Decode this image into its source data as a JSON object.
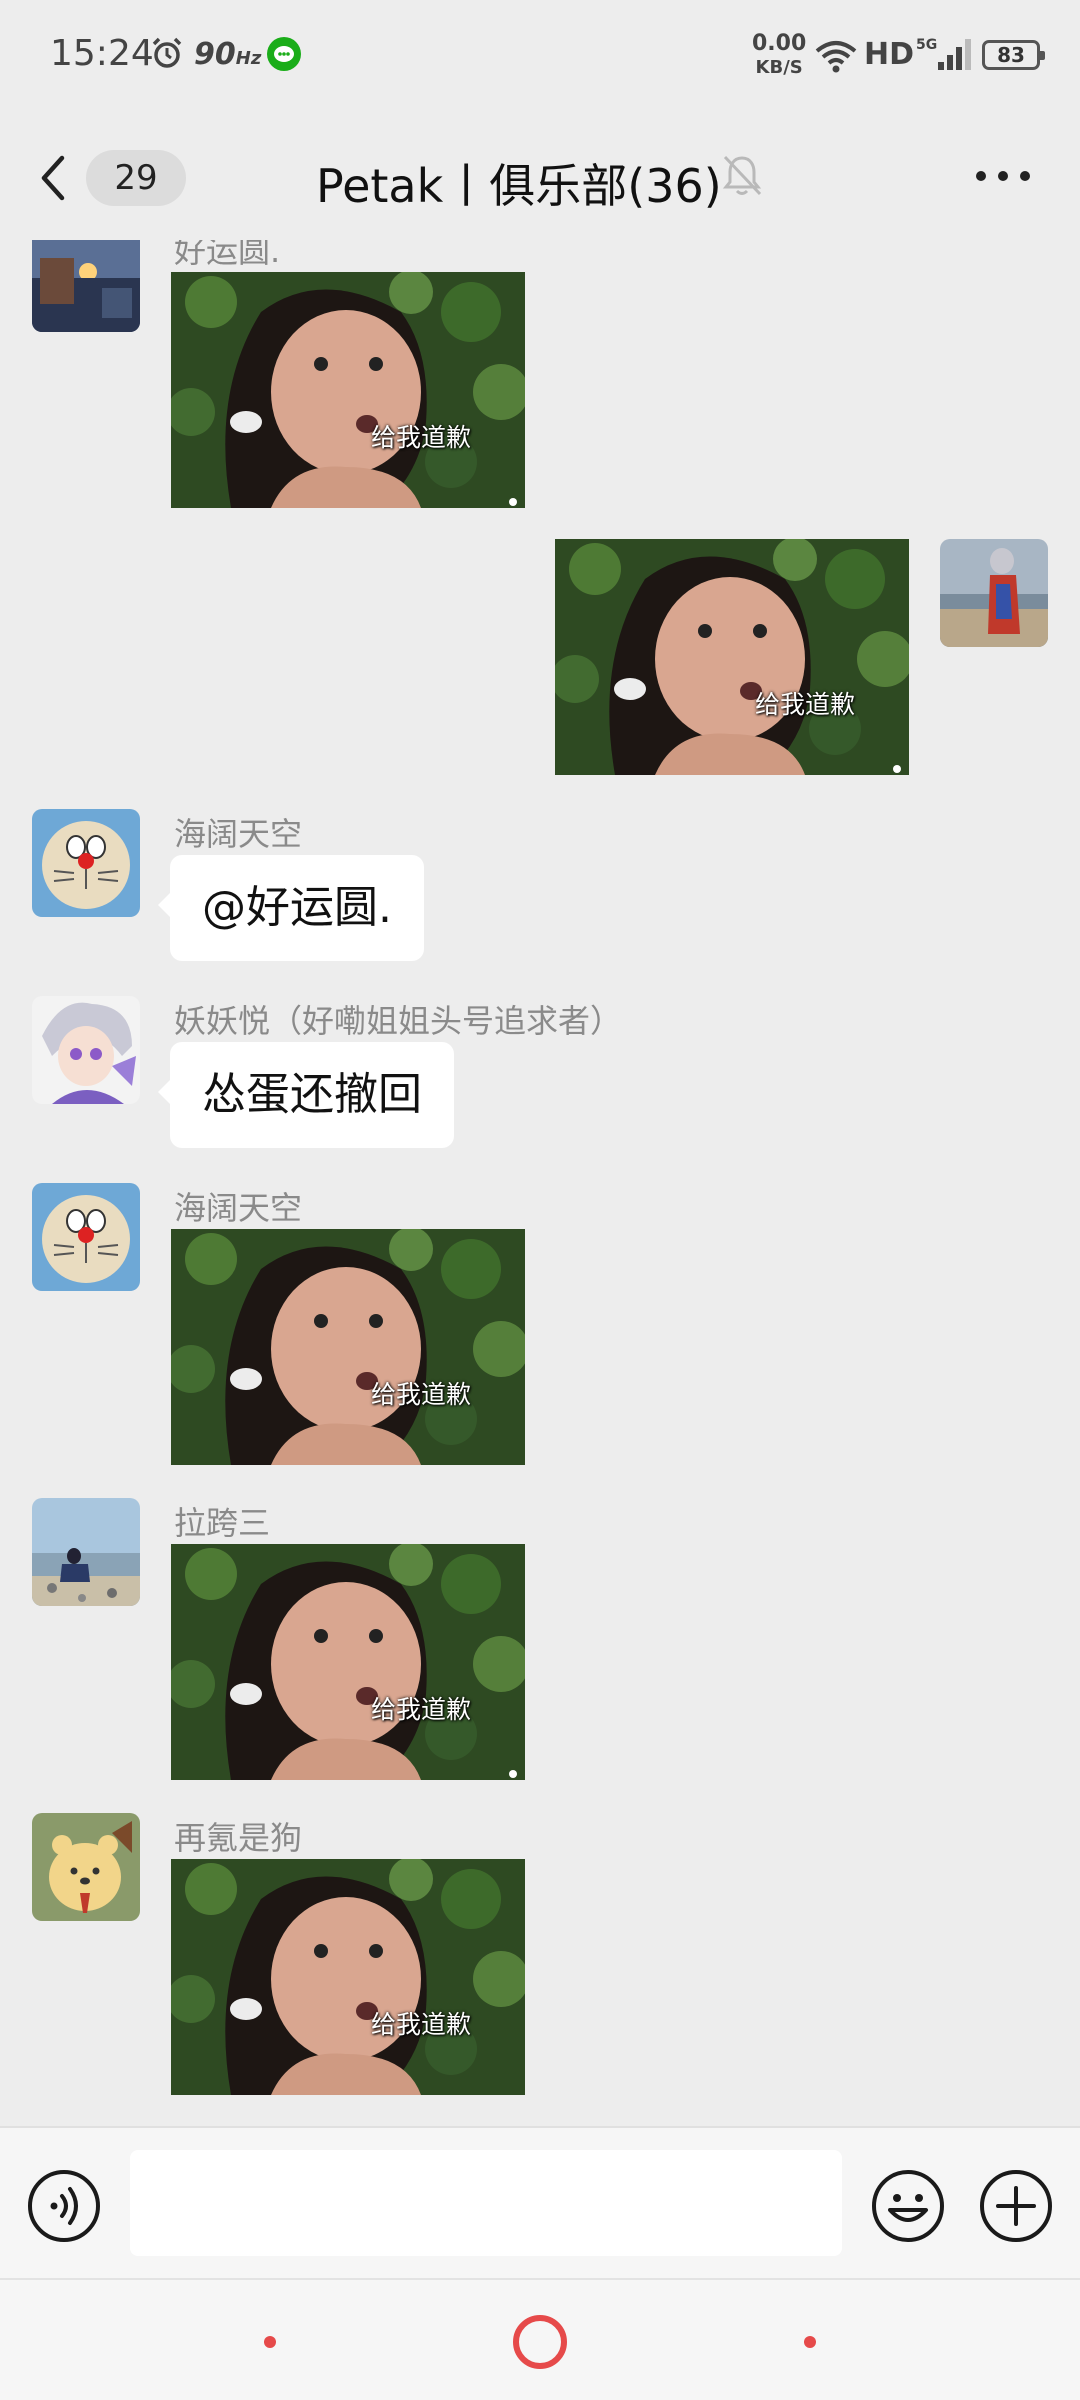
{
  "status_bar": {
    "time": "15:24",
    "refresh_rate": "90",
    "refresh_unit": "Hz",
    "net_speed_value": "0.00",
    "net_speed_unit": "KB/S",
    "network_label": "HD",
    "network_type": "5G",
    "battery": "83"
  },
  "header": {
    "unread_count": "29",
    "title": "Petak丨俱乐部(36)"
  },
  "messages": [
    {
      "side": "left",
      "sender": "好运圆.",
      "type": "sticker",
      "sticker_text": "给我道歉"
    },
    {
      "side": "right",
      "type": "sticker",
      "sticker_text": "给我道歉"
    },
    {
      "side": "left",
      "sender": "海阔天空",
      "type": "text",
      "text": "@好运圆."
    },
    {
      "side": "left",
      "sender": "妖妖悦（好嘞姐姐头号追求者）",
      "type": "text",
      "text": "怂蛋还撤回"
    },
    {
      "side": "left",
      "sender": "海阔天空",
      "type": "sticker",
      "sticker_text": "给我道歉"
    },
    {
      "side": "left",
      "sender": "拉跨三",
      "type": "sticker",
      "sticker_text": "给我道歉"
    },
    {
      "side": "left",
      "sender": "再氪是狗",
      "type": "sticker",
      "sticker_text": "给我道歉"
    }
  ],
  "colors": {
    "background": "#ededed",
    "bubble": "#ffffff",
    "nav_accent": "#e64a4a"
  }
}
